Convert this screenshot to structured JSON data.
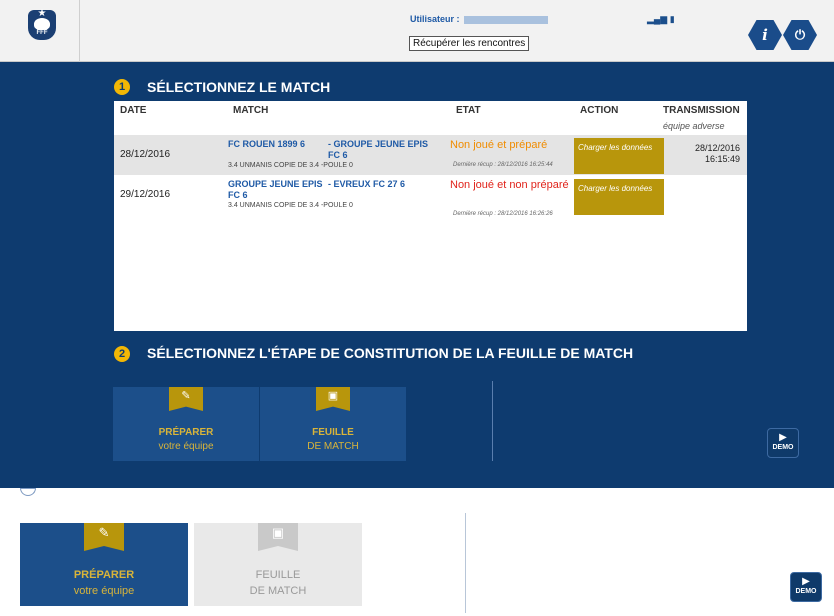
{
  "header": {
    "user_label": "Utilisateur :",
    "recup_button": "Récupérer les rencontres",
    "signal_icon": "signal-battery-icon",
    "info_button": "i",
    "power_button": "⏻"
  },
  "section1": {
    "number": "1",
    "title": "SÉLECTIONNEZ LE MATCH"
  },
  "table": {
    "headers": {
      "date": "DATE",
      "match": "MATCH",
      "etat": "ETAT",
      "action": "ACTION",
      "transmission": "TRANSMISSION",
      "transmission_sub": "équipe adverse"
    },
    "rows": [
      {
        "date": "28/12/2016",
        "home": "FC ROUEN 1899 6",
        "away": "- GROUPE JEUNE EPIS FC 6",
        "competition": "3.4 UNMANIS COPIE DE 3.4 -POULE 0",
        "etat": "Non joué et préparé",
        "etat_color": "#f08c00",
        "recup": "Dernière récup : 28/12/2016 16:25:44",
        "action": "Charger les données",
        "transmission_date": "28/12/2016",
        "transmission_time": "16:15:49"
      },
      {
        "date": "29/12/2016",
        "home": "GROUPE JEUNE EPIS FC 6",
        "away": "- EVREUX FC 27 6",
        "competition": "3.4 UNMANIS COPIE DE 3.4 -POULE 0",
        "etat": "Non joué et non préparé",
        "etat_color": "#e0241b",
        "recup": "Dernière récup : 28/12/2016 16:26:26",
        "action": "Charger les données",
        "transmission_date": "",
        "transmission_time": ""
      }
    ]
  },
  "section2": {
    "number": "2",
    "title": "SÉLECTIONNEZ L'ÉTAPE DE CONSTITUTION DE LA FEUILLE DE MATCH"
  },
  "steps": {
    "prepare_t1": "PRÉPARER",
    "prepare_t2": "votre équipe",
    "sheet_t1": "FEUILLE",
    "sheet_t2": "DE MATCH"
  },
  "demo_label": "DEMO",
  "lower": {
    "prepare_t1": "PRÉPARER",
    "prepare_t2": "votre équipe",
    "sheet_t1": "FEUILLE",
    "sheet_t2": "DE MATCH",
    "demo_label": "DEMO"
  },
  "colors": {
    "panel": "#0e3b6f",
    "gold": "#b8960c",
    "accent_blue": "#1f5aa6"
  }
}
